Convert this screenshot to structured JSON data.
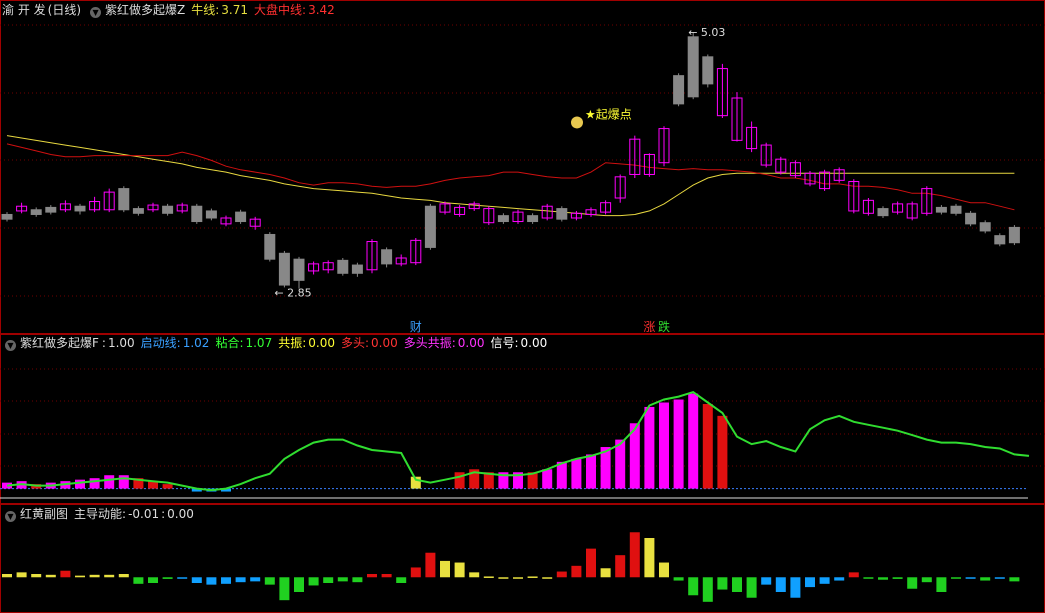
{
  "header1": {
    "stock": "渝 开 发",
    "period": "(日线)",
    "indicator": "紫红做多起爆Z",
    "niu_label": "牛线:",
    "niu_value": "3.71",
    "dapan_label": "大盘中线:",
    "dapan_value": "3.42"
  },
  "header2": {
    "indicator": "紫红做多起爆F",
    "main_label": ":",
    "main_value": "1.00",
    "items": [
      {
        "label": "启动线:",
        "value": "1.02",
        "color": "#3aa0ff"
      },
      {
        "label": "粘合:",
        "value": "1.07",
        "color": "#33ff33"
      },
      {
        "label": "共振:",
        "value": "0.00",
        "color": "#ffff33"
      },
      {
        "label": "多头:",
        "value": "0.00",
        "color": "#ff3333"
      },
      {
        "label": "多头共振:",
        "value": "0.00",
        "color": "#ff33ff"
      },
      {
        "label": "信号:",
        "value": "0.00",
        "color": "#ffffff"
      }
    ]
  },
  "header3": {
    "indicator": "红黄副图",
    "label": "主导动能:",
    "value1": "-0.01",
    "sep": ":",
    "value2": "0.00"
  },
  "colors": {
    "bg": "#000000",
    "frame": "#a00000",
    "grid": "#700000",
    "up": "#ff00ff",
    "down": "#888888",
    "red_line": "#d01010",
    "yellow_line": "#e8d840",
    "green_line": "#30dd30",
    "blue_dash": "#3a7fff",
    "hist_red": "#e01010",
    "hist_yellow": "#e8e040",
    "hist_green": "#20d020",
    "hist_blue": "#10a0ff"
  },
  "chart_data": [
    {
      "type": "candlestick",
      "pane": "main",
      "ylim": [
        2.6,
        5.15
      ],
      "series": [
        {
          "name": "牛线",
          "color": "#e8d840",
          "values": [
            4.15,
            4.13,
            4.11,
            4.09,
            4.07,
            4.05,
            4.03,
            4.01,
            3.99,
            3.97,
            3.95,
            3.93,
            3.91,
            3.88,
            3.86,
            3.84,
            3.81,
            3.79,
            3.77,
            3.74,
            3.72,
            3.7,
            3.69,
            3.68,
            3.67,
            3.66,
            3.64,
            3.62,
            3.61,
            3.6,
            3.58,
            3.57,
            3.56,
            3.55,
            3.54,
            3.53,
            3.52,
            3.51,
            3.5,
            3.49,
            3.48,
            3.47,
            3.47,
            3.48,
            3.51,
            3.57,
            3.65,
            3.73,
            3.79,
            3.82,
            3.83,
            3.83,
            3.83,
            3.83,
            3.83,
            3.83,
            3.83,
            3.83,
            3.83,
            3.83,
            3.83,
            3.83,
            3.83,
            3.83,
            3.83,
            3.83,
            3.83,
            3.83,
            3.83,
            3.83
          ]
        },
        {
          "name": "大盘中线",
          "color": "#d01010",
          "values": [
            4.08,
            4.05,
            4.02,
            3.99,
            3.97,
            3.97,
            3.98,
            3.98,
            3.98,
            3.98,
            3.98,
            3.98,
            4.01,
            3.98,
            3.94,
            3.89,
            3.86,
            3.84,
            3.82,
            3.79,
            3.75,
            3.73,
            3.75,
            3.75,
            3.74,
            3.72,
            3.71,
            3.72,
            3.72,
            3.74,
            3.77,
            3.79,
            3.8,
            3.81,
            3.84,
            3.84,
            3.82,
            3.8,
            3.79,
            3.79,
            3.84,
            3.92,
            3.91,
            3.9,
            3.88,
            3.87,
            3.86,
            3.87,
            3.86,
            3.86,
            3.85,
            3.84,
            3.82,
            3.79,
            3.79,
            3.77,
            3.74,
            3.74,
            3.72,
            3.72,
            3.71,
            3.69,
            3.66,
            3.66,
            3.64,
            3.61,
            3.58,
            3.58,
            3.55,
            3.52
          ]
        }
      ],
      "candles": [
        [
          3.48,
          3.44,
          3.5,
          3.42
        ],
        [
          3.51,
          3.55,
          3.58,
          3.49
        ],
        [
          3.52,
          3.48,
          3.54,
          3.46
        ],
        [
          3.54,
          3.5,
          3.56,
          3.48
        ],
        [
          3.52,
          3.57,
          3.6,
          3.5
        ],
        [
          3.55,
          3.51,
          3.57,
          3.48
        ],
        [
          3.52,
          3.59,
          3.63,
          3.5
        ],
        [
          3.52,
          3.67,
          3.7,
          3.5
        ],
        [
          3.7,
          3.52,
          3.72,
          3.5
        ],
        [
          3.53,
          3.49,
          3.55,
          3.47
        ],
        [
          3.52,
          3.56,
          3.58,
          3.5
        ],
        [
          3.55,
          3.49,
          3.57,
          3.47
        ],
        [
          3.51,
          3.56,
          3.58,
          3.49
        ],
        [
          3.55,
          3.42,
          3.57,
          3.4
        ],
        [
          3.51,
          3.45,
          3.53,
          3.43
        ],
        [
          3.4,
          3.45,
          3.47,
          3.38
        ],
        [
          3.5,
          3.42,
          3.52,
          3.4
        ],
        [
          3.38,
          3.44,
          3.46,
          3.35
        ],
        [
          3.31,
          3.1,
          3.33,
          3.08
        ],
        [
          3.15,
          2.88,
          3.17,
          2.86
        ],
        [
          3.1,
          2.92,
          3.12,
          2.85
        ],
        [
          3.0,
          3.06,
          3.08,
          2.97
        ],
        [
          3.01,
          3.07,
          3.09,
          2.98
        ],
        [
          3.09,
          2.98,
          3.11,
          2.96
        ],
        [
          3.05,
          2.98,
          3.07,
          2.95
        ],
        [
          3.01,
          3.25,
          3.27,
          2.98
        ],
        [
          3.18,
          3.06,
          3.2,
          3.03
        ],
        [
          3.06,
          3.11,
          3.14,
          3.04
        ],
        [
          3.07,
          3.26,
          3.28,
          3.05
        ],
        [
          3.55,
          3.2,
          3.57,
          3.18
        ],
        [
          3.5,
          3.57,
          3.59,
          3.48
        ],
        [
          3.48,
          3.54,
          3.56,
          3.46
        ],
        [
          3.53,
          3.57,
          3.59,
          3.51
        ],
        [
          3.41,
          3.53,
          3.55,
          3.39
        ],
        [
          3.47,
          3.42,
          3.49,
          3.4
        ],
        [
          3.42,
          3.5,
          3.52,
          3.4
        ],
        [
          3.47,
          3.42,
          3.49,
          3.4
        ],
        [
          3.45,
          3.55,
          3.57,
          3.43
        ],
        [
          3.53,
          3.44,
          3.55,
          3.42
        ],
        [
          3.45,
          3.49,
          3.51,
          3.43
        ],
        [
          3.48,
          3.52,
          3.54,
          3.46
        ],
        [
          3.5,
          3.58,
          3.6,
          3.48
        ],
        [
          3.62,
          3.8,
          3.82,
          3.58
        ],
        [
          3.82,
          4.12,
          4.15,
          3.79
        ],
        [
          3.82,
          3.99,
          4.0,
          3.8
        ],
        [
          3.92,
          4.21,
          4.23,
          3.89
        ],
        [
          4.66,
          4.42,
          4.68,
          4.4
        ],
        [
          4.99,
          4.48,
          5.03,
          4.46
        ],
        [
          4.82,
          4.59,
          4.84,
          4.56
        ],
        [
          4.32,
          4.72,
          4.76,
          4.3
        ],
        [
          4.11,
          4.47,
          4.52,
          4.1
        ],
        [
          4.04,
          4.22,
          4.27,
          4.01
        ],
        [
          3.9,
          4.07,
          4.09,
          3.88
        ],
        [
          3.84,
          3.95,
          3.97,
          3.82
        ],
        [
          3.81,
          3.92,
          3.94,
          3.79
        ],
        [
          3.74,
          3.83,
          3.85,
          3.72
        ],
        [
          3.7,
          3.84,
          3.86,
          3.68
        ],
        [
          3.77,
          3.86,
          3.88,
          3.75
        ],
        [
          3.51,
          3.76,
          3.78,
          3.49
        ],
        [
          3.49,
          3.6,
          3.62,
          3.47
        ],
        [
          3.53,
          3.47,
          3.55,
          3.45
        ],
        [
          3.5,
          3.57,
          3.59,
          3.48
        ],
        [
          3.45,
          3.57,
          3.59,
          3.43
        ],
        [
          3.49,
          3.7,
          3.72,
          3.47
        ],
        [
          3.54,
          3.5,
          3.56,
          3.48
        ],
        [
          3.55,
          3.49,
          3.57,
          3.47
        ],
        [
          3.49,
          3.4,
          3.51,
          3.38
        ],
        [
          3.41,
          3.34,
          3.43,
          3.32
        ],
        [
          3.3,
          3.23,
          3.32,
          3.21
        ],
        [
          3.37,
          3.24,
          3.39,
          3.22
        ]
      ],
      "annotations": [
        {
          "text": "← 2.85",
          "x": 19,
          "y": 2.85
        },
        {
          "text": "← 5.03",
          "x": 47,
          "y": 5.03
        },
        {
          "text": "★起爆点",
          "x": 40,
          "y": 4.33
        },
        {
          "text": "财",
          "x": 28
        },
        {
          "text": "涨",
          "x": 44
        },
        {
          "text": "跌",
          "x": 45
        }
      ]
    },
    {
      "type": "bar+line",
      "pane": "oscillator",
      "ylim": [
        0.95,
        1.9
      ],
      "line": {
        "color": "#30dd30",
        "values": [
          1.02,
          1.03,
          1.02,
          1.02,
          1.03,
          1.04,
          1.05,
          1.06,
          1.07,
          1.06,
          1.05,
          1.04,
          1.02,
          1.0,
          0.99,
          1.0,
          1.03,
          1.07,
          1.1,
          1.2,
          1.26,
          1.31,
          1.33,
          1.33,
          1.29,
          1.26,
          1.25,
          1.24,
          1.06,
          1.04,
          1.06,
          1.08,
          1.11,
          1.1,
          1.09,
          1.09,
          1.1,
          1.13,
          1.17,
          1.2,
          1.22,
          1.25,
          1.3,
          1.4,
          1.56,
          1.6,
          1.62,
          1.65,
          1.58,
          1.51,
          1.35,
          1.3,
          1.32,
          1.28,
          1.25,
          1.4,
          1.46,
          1.49,
          1.45,
          1.43,
          1.41,
          1.39,
          1.36,
          1.33,
          1.31,
          1.31,
          1.3,
          1.28,
          1.27,
          1.23,
          1.22
        ]
      },
      "dash_level": 1.0,
      "bars": [
        {
          "x": 0,
          "v": 1.04,
          "c": "m"
        },
        {
          "x": 1,
          "v": 1.05,
          "c": "m"
        },
        {
          "x": 2,
          "v": 1.03,
          "c": "r"
        },
        {
          "x": 3,
          "v": 1.04,
          "c": "m"
        },
        {
          "x": 4,
          "v": 1.05,
          "c": "m"
        },
        {
          "x": 5,
          "v": 1.06,
          "c": "m"
        },
        {
          "x": 6,
          "v": 1.07,
          "c": "m"
        },
        {
          "x": 7,
          "v": 1.09,
          "c": "m"
        },
        {
          "x": 8,
          "v": 1.09,
          "c": "m"
        },
        {
          "x": 9,
          "v": 1.07,
          "c": "r"
        },
        {
          "x": 10,
          "v": 1.05,
          "c": "r"
        },
        {
          "x": 11,
          "v": 1.03,
          "c": "r"
        },
        {
          "x": 13,
          "v": 0.98,
          "c": "b"
        },
        {
          "x": 14,
          "v": 0.98,
          "c": "b"
        },
        {
          "x": 15,
          "v": 0.98,
          "c": "b"
        },
        {
          "x": 28,
          "v": 1.08,
          "c": "y"
        },
        {
          "x": 31,
          "v": 1.11,
          "c": "r"
        },
        {
          "x": 32,
          "v": 1.13,
          "c": "r"
        },
        {
          "x": 33,
          "v": 1.11,
          "c": "r"
        },
        {
          "x": 34,
          "v": 1.11,
          "c": "m"
        },
        {
          "x": 35,
          "v": 1.11,
          "c": "m"
        },
        {
          "x": 36,
          "v": 1.11,
          "c": "r"
        },
        {
          "x": 37,
          "v": 1.13,
          "c": "m"
        },
        {
          "x": 38,
          "v": 1.18,
          "c": "m"
        },
        {
          "x": 39,
          "v": 1.2,
          "c": "m"
        },
        {
          "x": 40,
          "v": 1.23,
          "c": "m"
        },
        {
          "x": 41,
          "v": 1.28,
          "c": "m"
        },
        {
          "x": 42,
          "v": 1.33,
          "c": "m"
        },
        {
          "x": 43,
          "v": 1.44,
          "c": "m"
        },
        {
          "x": 44,
          "v": 1.55,
          "c": "m"
        },
        {
          "x": 45,
          "v": 1.58,
          "c": "m"
        },
        {
          "x": 46,
          "v": 1.6,
          "c": "m"
        },
        {
          "x": 47,
          "v": 1.64,
          "c": "m"
        },
        {
          "x": 48,
          "v": 1.57,
          "c": "r"
        },
        {
          "x": 49,
          "v": 1.49,
          "c": "r"
        }
      ]
    },
    {
      "type": "histogram",
      "pane": "sub",
      "ylim": [
        -0.04,
        0.07
      ],
      "values": [
        0.004,
        0.006,
        0.004,
        0.003,
        0.008,
        0.002,
        0.003,
        0.003,
        0.004,
        -0.008,
        -0.007,
        -0.002,
        -0.001,
        -0.007,
        -0.009,
        -0.008,
        -0.006,
        -0.005,
        -0.009,
        -0.028,
        -0.018,
        -0.01,
        -0.007,
        -0.005,
        -0.006,
        0.004,
        0.004,
        -0.007,
        0.012,
        0.03,
        0.02,
        0.018,
        0.006,
        0.001,
        -0.001,
        0.0,
        0.001,
        0.0,
        0.007,
        0.014,
        0.035,
        0.011,
        0.027,
        0.055,
        0.048,
        0.018,
        -0.004,
        -0.022,
        -0.03,
        -0.015,
        -0.018,
        -0.025,
        -0.009,
        -0.018,
        -0.025,
        -0.012,
        -0.008,
        -0.004,
        0.006,
        -0.001,
        -0.003,
        -0.002,
        -0.014,
        -0.006,
        -0.018,
        -0.001,
        -0.001,
        -0.004,
        0.0,
        -0.005
      ],
      "colors": [
        "y",
        "y",
        "y",
        "y",
        "r",
        "y",
        "y",
        "y",
        "y",
        "g",
        "g",
        "g",
        "b",
        "b",
        "b",
        "b",
        "b",
        "b",
        "g",
        "g",
        "g",
        "g",
        "g",
        "g",
        "g",
        "r",
        "r",
        "g",
        "r",
        "r",
        "y",
        "y",
        "y",
        "y",
        "y",
        "y",
        "y",
        "y",
        "r",
        "r",
        "r",
        "y",
        "r",
        "r",
        "y",
        "y",
        "g",
        "g",
        "g",
        "g",
        "g",
        "g",
        "b",
        "b",
        "b",
        "b",
        "b",
        "b",
        "r",
        "g",
        "g",
        "g",
        "g",
        "g",
        "g",
        "g",
        "b",
        "g",
        "b",
        "g"
      ]
    }
  ]
}
